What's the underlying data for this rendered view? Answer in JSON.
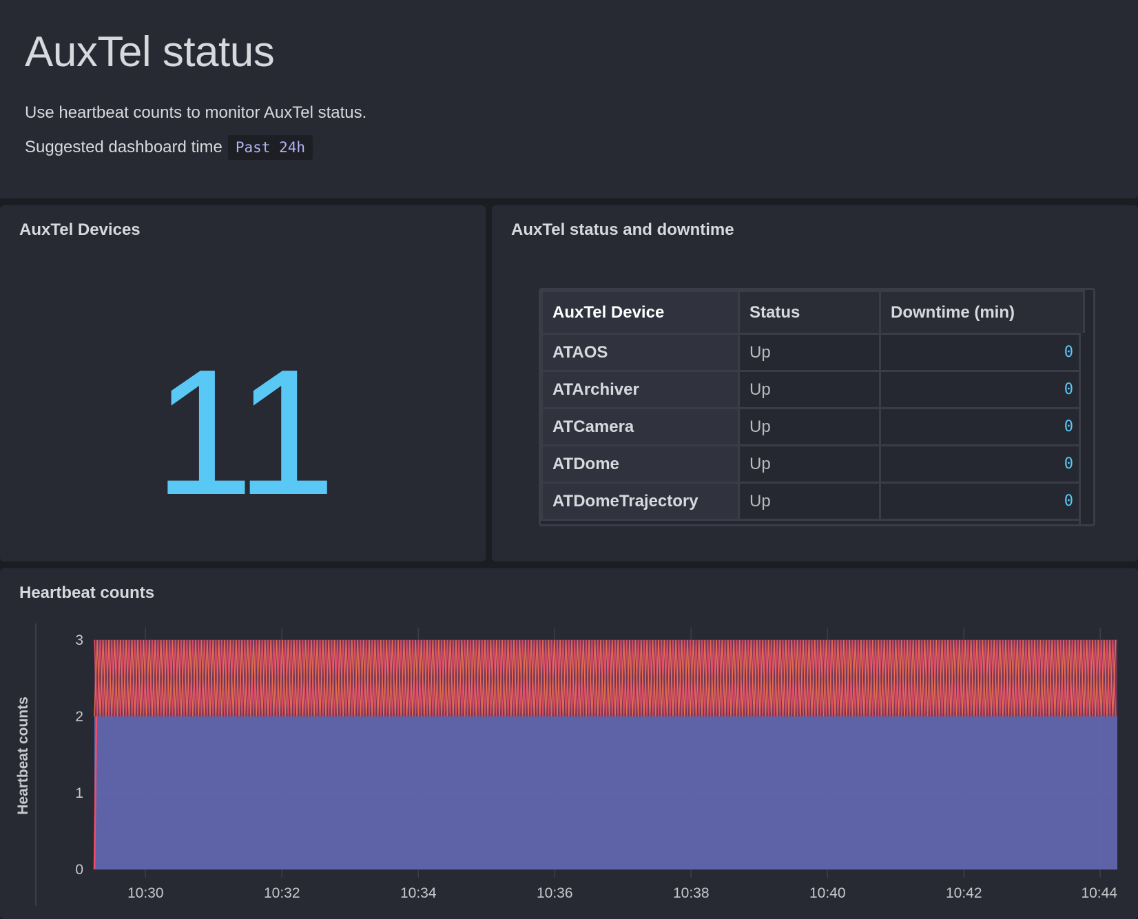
{
  "header": {
    "title": "AuxTel status",
    "description": "Use heartbeat counts to monitor AuxTel status.",
    "suggested_time_label": "Suggested dashboard time",
    "suggested_time_value": "Past 24h"
  },
  "devices_panel": {
    "title": "AuxTel Devices",
    "value": "11",
    "color": "#5ac8f5"
  },
  "status_panel": {
    "title": "AuxTel status and downtime",
    "columns": [
      "AuxTel Device",
      "Status",
      "Downtime (min)"
    ],
    "rows": [
      {
        "device": "ATAOS",
        "status": "Up",
        "downtime": "0"
      },
      {
        "device": "ATArchiver",
        "status": "Up",
        "downtime": "0"
      },
      {
        "device": "ATCamera",
        "status": "Up",
        "downtime": "0"
      },
      {
        "device": "ATDome",
        "status": "Up",
        "downtime": "0"
      },
      {
        "device": "ATDomeTrajectory",
        "status": "Up",
        "downtime": "0"
      }
    ]
  },
  "heartbeat_panel": {
    "title": "Heartbeat counts"
  },
  "chart_data": {
    "type": "area",
    "ylabel": "Heartbeat counts",
    "xlabel": "",
    "x_ticks": [
      "10:30",
      "10:32",
      "10:34",
      "10:36",
      "10:38",
      "10:40",
      "10:42",
      "10:44"
    ],
    "y_ticks": [
      "0",
      "1",
      "2",
      "3"
    ],
    "ylim": [
      0,
      3
    ],
    "xlim": [
      "10:29:15",
      "10:44:15"
    ],
    "grid": true,
    "series": [
      {
        "color": "#6166ae",
        "values_range": [
          2,
          2
        ],
        "description_value": 2
      },
      {
        "color": "#f24d6b",
        "values_range": [
          2,
          3
        ]
      },
      {
        "color": "#f2734d",
        "values_range": [
          2,
          3
        ]
      }
    ]
  }
}
